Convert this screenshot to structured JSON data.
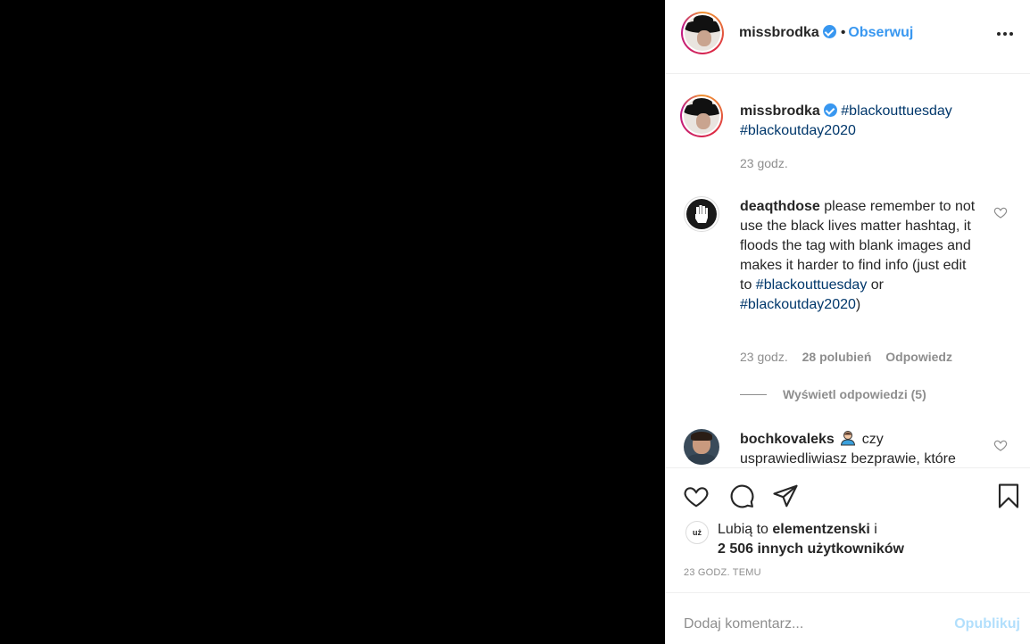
{
  "post": {
    "author": "missbrodka",
    "follow_label": "Obserwuj",
    "separator": "•"
  },
  "caption": {
    "author": "missbrodka",
    "tag1": "#blackouttuesday",
    "tag2": "#blackoutday2020",
    "time": "23 godz."
  },
  "comments": [
    {
      "author": "deaqthdose",
      "text": "please remember to not use the black lives matter hashtag, it floods the tag with blank images and makes it harder to find info (just edit to",
      "tag1": "#blackouttuesday",
      "or": "or",
      "tag2": "#blackoutday2020",
      "close": ")",
      "time": "23 godz.",
      "likes": "28 polubień",
      "reply": "Odpowiedz",
      "view_replies": "Wyświetl odpowiedzi (5)"
    },
    {
      "author": "bochkovaleks",
      "text": "czy usprawiedliwiasz bezprawie, które"
    }
  ],
  "likes": {
    "prefix": "Lubią to",
    "user": "elementzenski",
    "conj": "i",
    "count": "2 506 innych użytkowników"
  },
  "timeago": "23 GODZ. TEMU",
  "comment_box": {
    "placeholder": "Dodaj komentarz...",
    "publish": "Opublikuj"
  },
  "icons": {
    "like": "heart-icon",
    "comment": "comment-icon",
    "share": "share-icon",
    "save": "bookmark-icon",
    "more": "more-options-icon",
    "verified": "verified-badge-icon"
  },
  "colors": {
    "link": "#3897f0",
    "hashtag": "#00376b",
    "muted": "#8e8e8e"
  }
}
